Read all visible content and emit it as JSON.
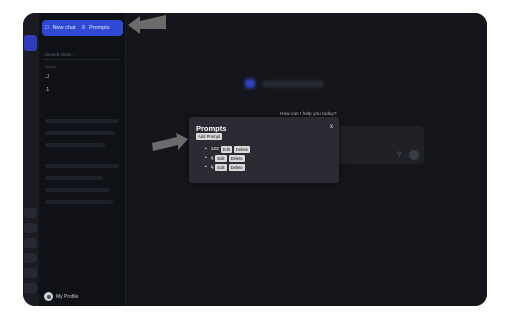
{
  "sidebar": {
    "new_chat_label": "New chat",
    "prompts_label": "Prompts",
    "search_placeholder": "Search chats...",
    "section_label": "Today",
    "history": [
      ".J",
      ".1"
    ],
    "profile_label": "My Profile"
  },
  "main": {
    "help_text": "How can I help you today?"
  },
  "modal": {
    "title": "Prompts",
    "close_label": "x",
    "add_button": "Add Prompt",
    "prompts": [
      {
        "text": "123",
        "edit": "Edit",
        "delete": "Delete"
      },
      {
        "text": "q",
        "edit": "Edit",
        "delete": "Delete"
      },
      {
        "text": "q",
        "edit": "Edit",
        "delete": "Delete"
      }
    ]
  },
  "colors": {
    "accent": "#3049d4",
    "background": "#15161b",
    "modal": "#2a2b33",
    "arrow": "#6b6b6b"
  },
  "icons": [
    "new-chat-icon",
    "prompts-icon",
    "paperclip-icon",
    "send-icon",
    "avatar-icon",
    "pointer-arrow-icon"
  ]
}
